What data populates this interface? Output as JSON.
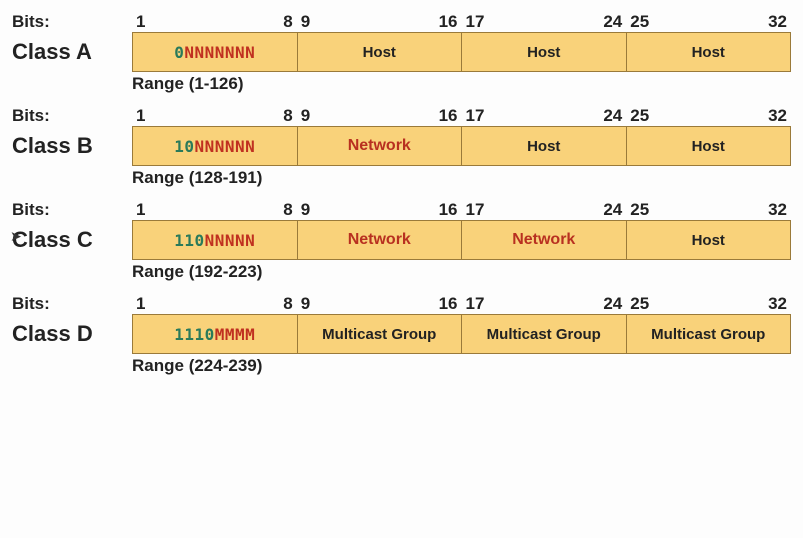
{
  "labels": {
    "bits": "Bits:",
    "range_prefix": "Range "
  },
  "bit_positions": [
    "1",
    "8",
    "9",
    "16",
    "17",
    "24",
    "25",
    "32"
  ],
  "classes": [
    {
      "name": "Class A",
      "range": "(1-126)",
      "octets": [
        {
          "type": "pattern",
          "prefix": "0",
          "mask": "NNNNNNN"
        },
        {
          "type": "host",
          "text": "Host"
        },
        {
          "type": "host",
          "text": "Host"
        },
        {
          "type": "host",
          "text": "Host"
        }
      ]
    },
    {
      "name": "Class B",
      "range": "(128-191)",
      "octets": [
        {
          "type": "pattern",
          "prefix": "10",
          "mask": "NNNNNN"
        },
        {
          "type": "net",
          "text": "Network"
        },
        {
          "type": "host",
          "text": "Host"
        },
        {
          "type": "host",
          "text": "Host"
        }
      ]
    },
    {
      "name": "Class C",
      "range": "(192-223)",
      "octets": [
        {
          "type": "pattern",
          "prefix": "110",
          "mask": "NNNNN"
        },
        {
          "type": "net",
          "text": "Network"
        },
        {
          "type": "net",
          "text": "Network"
        },
        {
          "type": "host",
          "text": "Host"
        }
      ]
    },
    {
      "name": "Class D",
      "range": "(224-239)",
      "octets": [
        {
          "type": "pattern",
          "prefix": "1110",
          "mask": "MMMM"
        },
        {
          "type": "host",
          "text": "Multicast Group"
        },
        {
          "type": "host",
          "text": "Multicast Group"
        },
        {
          "type": "host",
          "text": "Multicast Group"
        }
      ]
    }
  ]
}
